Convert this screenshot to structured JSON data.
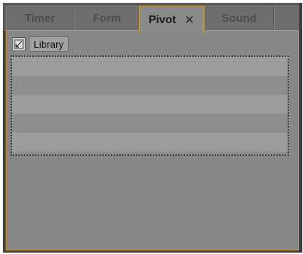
{
  "tabs": [
    {
      "label": "Timer",
      "active": false
    },
    {
      "label": "Form",
      "active": false
    },
    {
      "label": "Pivot",
      "active": true,
      "close_glyph": "✕"
    },
    {
      "label": "Sound",
      "active": false
    },
    {
      "label": "",
      "active": false
    }
  ],
  "toolbar": {
    "icon": "pivot-library-icon",
    "library_label": "Library"
  },
  "list": {
    "rows": 5
  },
  "colors": {
    "accent": "#c79a36",
    "panel": "#878787",
    "tab_inactive": "#6e6e6e",
    "tab_active": "#8a8a8a"
  }
}
